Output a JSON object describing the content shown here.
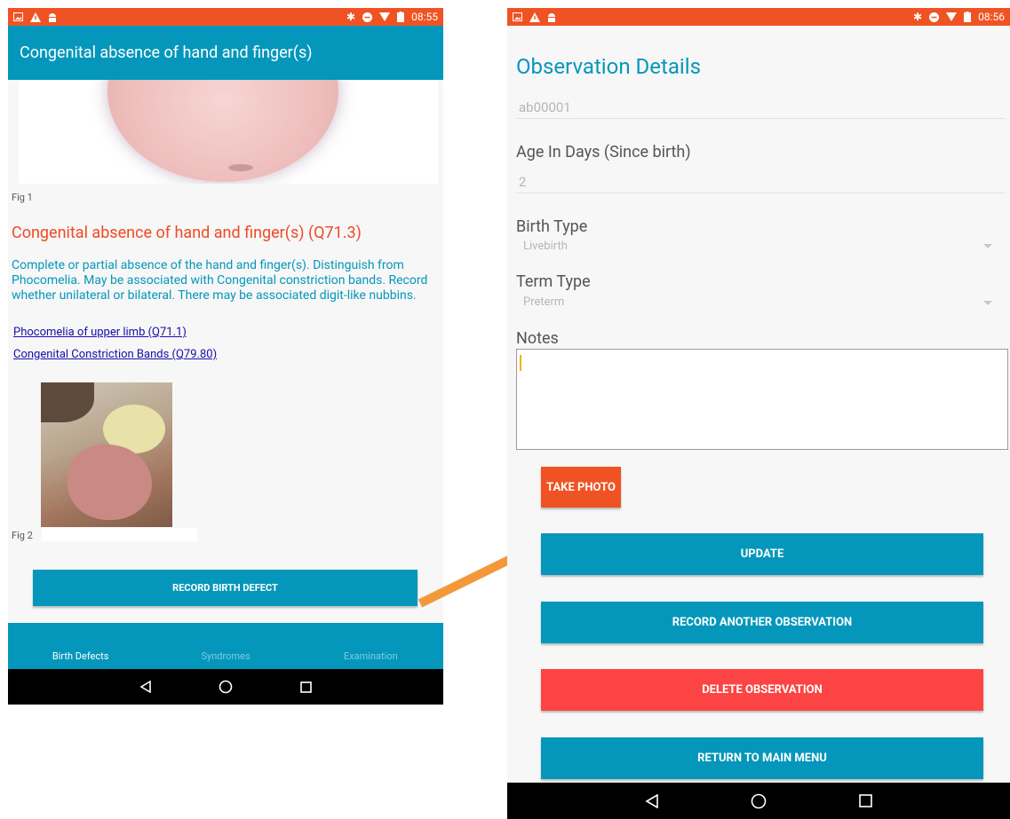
{
  "left_screen": {
    "status": {
      "time": "08:55"
    },
    "app_bar_title": "Congenital absence of hand and finger(s)",
    "fig1_caption": "Fig 1",
    "condition_title": "Congenital absence of hand and finger(s) (Q71.3)",
    "description": "Complete or partial absence of the hand and finger(s). Distinguish from Phocomelia. May be associated with Congenital constriction bands. Record whether unilateral or bilateral. There may be associated digit-like nubbins.",
    "links": [
      "Phocomelia of upper limb (Q71.1)",
      "Congenital Constriction Bands (Q79.80)"
    ],
    "fig2_caption": "Fig 2",
    "record_button": "RECORD BIRTH DEFECT",
    "tabs": [
      "Birth Defects",
      "Syndromes",
      "Examination"
    ]
  },
  "right_screen": {
    "status": {
      "time": "08:56"
    },
    "title": "Observation Details",
    "id_value": "ab00001",
    "age_label": "Age In Days (Since birth)",
    "age_value": "2",
    "birth_type_label": "Birth Type",
    "birth_type_value": "Livebirth",
    "term_type_label": "Term Type",
    "term_type_value": "Preterm",
    "notes_label": "Notes",
    "notes_value": "",
    "take_photo": "TAKE PHOTO",
    "update": "UPDATE",
    "record_another": "RECORD ANOTHER OBSERVATION",
    "delete": "DELETE OBSERVATION",
    "return": "RETURN TO MAIN MENU"
  },
  "colors": {
    "status_bar": "#f05323",
    "primary": "#0497bb",
    "accent_orange": "#f05323",
    "delete_red": "#fd4444",
    "arrow": "#f29a3b"
  }
}
